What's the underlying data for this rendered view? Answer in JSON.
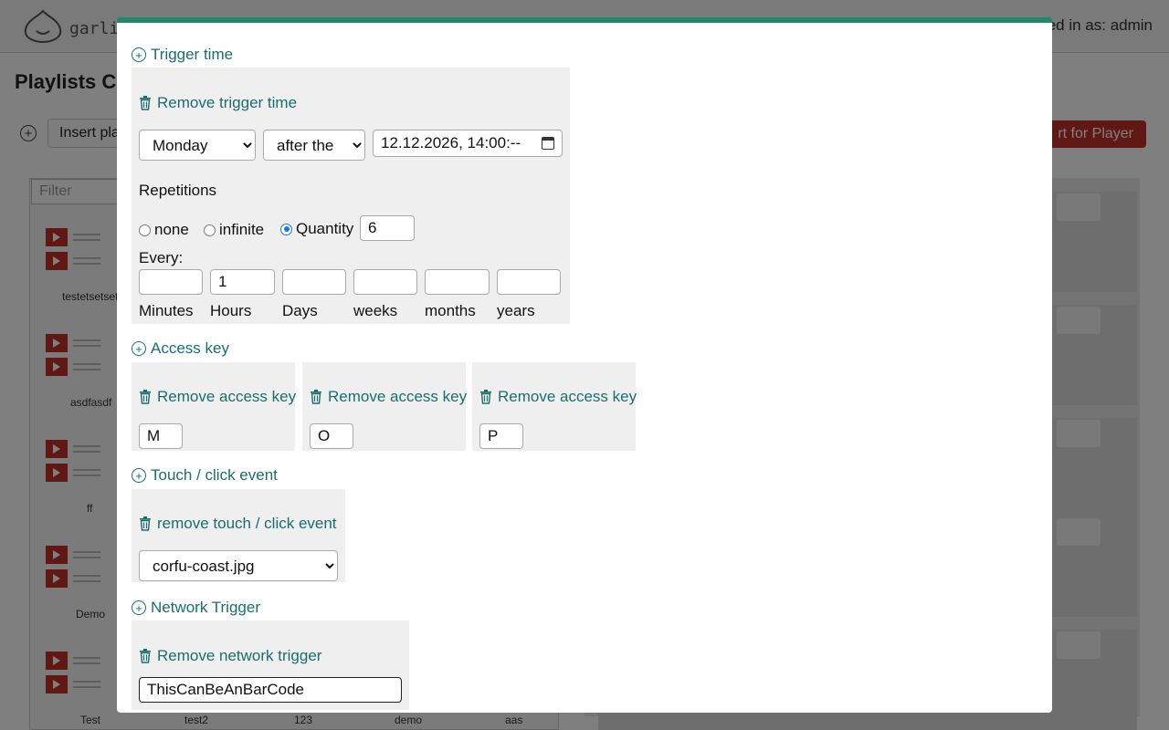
{
  "background": {
    "logo_text": "garlic",
    "logged_in": "ged in as: admin",
    "page_title": "Playlists Co",
    "insert_button": "Insert pla",
    "start_button": "rt for Player",
    "filter_placeholder": "Filter",
    "playlist_labels": [
      "testetsetset",
      "asdfasdf",
      "ff",
      "Demo",
      "Test"
    ],
    "bottom_labels": [
      "test2",
      "123",
      "demo",
      "aas"
    ]
  },
  "modal": {
    "trigger_time": {
      "heading": "Trigger time",
      "remove_label": "Remove trigger time",
      "day_select": "Monday",
      "relation_select": "after the",
      "datetime_value": "12.12.2026, 14:00:--",
      "repetitions_label": "Repetitions",
      "radio_none": "none",
      "radio_infinite": "infinite",
      "radio_quantity": "Quantity",
      "quantity_value": "6",
      "every_label": "Every:",
      "interval_fields": [
        {
          "label": "Minutes",
          "value": ""
        },
        {
          "label": "Hours",
          "value": "1"
        },
        {
          "label": "Days",
          "value": ""
        },
        {
          "label": "weeks",
          "value": ""
        },
        {
          "label": "months",
          "value": ""
        },
        {
          "label": "years",
          "value": ""
        }
      ]
    },
    "access_key": {
      "heading": "Access key",
      "items": [
        {
          "remove_label": "Remove access key",
          "value": "M"
        },
        {
          "remove_label": "Remove access key",
          "value": "O"
        },
        {
          "remove_label": "Remove access key",
          "value": "P"
        }
      ]
    },
    "touch_event": {
      "heading": "Touch / click event",
      "remove_label": "remove touch / click event",
      "select_value": "corfu-coast.jpg"
    },
    "network_trigger": {
      "heading": "Network Trigger",
      "remove_label": "Remove network trigger",
      "input_value": "ThisCanBeAnBarCode"
    }
  },
  "colors": {
    "accent": "#1a6e6e",
    "modal_top_bar": "#1e8a6a",
    "brand_red": "#c0302b"
  }
}
